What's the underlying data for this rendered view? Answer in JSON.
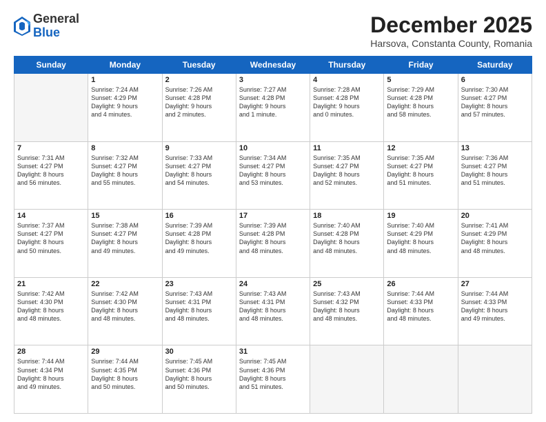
{
  "header": {
    "logo_general": "General",
    "logo_blue": "Blue",
    "month_title": "December 2025",
    "subtitle": "Harsova, Constanta County, Romania"
  },
  "weekdays": [
    "Sunday",
    "Monday",
    "Tuesday",
    "Wednesday",
    "Thursday",
    "Friday",
    "Saturday"
  ],
  "weeks": [
    [
      {
        "day": "",
        "detail": ""
      },
      {
        "day": "1",
        "detail": "Sunrise: 7:24 AM\nSunset: 4:29 PM\nDaylight: 9 hours\nand 4 minutes."
      },
      {
        "day": "2",
        "detail": "Sunrise: 7:26 AM\nSunset: 4:28 PM\nDaylight: 9 hours\nand 2 minutes."
      },
      {
        "day": "3",
        "detail": "Sunrise: 7:27 AM\nSunset: 4:28 PM\nDaylight: 9 hours\nand 1 minute."
      },
      {
        "day": "4",
        "detail": "Sunrise: 7:28 AM\nSunset: 4:28 PM\nDaylight: 9 hours\nand 0 minutes."
      },
      {
        "day": "5",
        "detail": "Sunrise: 7:29 AM\nSunset: 4:28 PM\nDaylight: 8 hours\nand 58 minutes."
      },
      {
        "day": "6",
        "detail": "Sunrise: 7:30 AM\nSunset: 4:27 PM\nDaylight: 8 hours\nand 57 minutes."
      }
    ],
    [
      {
        "day": "7",
        "detail": "Sunrise: 7:31 AM\nSunset: 4:27 PM\nDaylight: 8 hours\nand 56 minutes."
      },
      {
        "day": "8",
        "detail": "Sunrise: 7:32 AM\nSunset: 4:27 PM\nDaylight: 8 hours\nand 55 minutes."
      },
      {
        "day": "9",
        "detail": "Sunrise: 7:33 AM\nSunset: 4:27 PM\nDaylight: 8 hours\nand 54 minutes."
      },
      {
        "day": "10",
        "detail": "Sunrise: 7:34 AM\nSunset: 4:27 PM\nDaylight: 8 hours\nand 53 minutes."
      },
      {
        "day": "11",
        "detail": "Sunrise: 7:35 AM\nSunset: 4:27 PM\nDaylight: 8 hours\nand 52 minutes."
      },
      {
        "day": "12",
        "detail": "Sunrise: 7:35 AM\nSunset: 4:27 PM\nDaylight: 8 hours\nand 51 minutes."
      },
      {
        "day": "13",
        "detail": "Sunrise: 7:36 AM\nSunset: 4:27 PM\nDaylight: 8 hours\nand 51 minutes."
      }
    ],
    [
      {
        "day": "14",
        "detail": "Sunrise: 7:37 AM\nSunset: 4:27 PM\nDaylight: 8 hours\nand 50 minutes."
      },
      {
        "day": "15",
        "detail": "Sunrise: 7:38 AM\nSunset: 4:27 PM\nDaylight: 8 hours\nand 49 minutes."
      },
      {
        "day": "16",
        "detail": "Sunrise: 7:39 AM\nSunset: 4:28 PM\nDaylight: 8 hours\nand 49 minutes."
      },
      {
        "day": "17",
        "detail": "Sunrise: 7:39 AM\nSunset: 4:28 PM\nDaylight: 8 hours\nand 48 minutes."
      },
      {
        "day": "18",
        "detail": "Sunrise: 7:40 AM\nSunset: 4:28 PM\nDaylight: 8 hours\nand 48 minutes."
      },
      {
        "day": "19",
        "detail": "Sunrise: 7:40 AM\nSunset: 4:29 PM\nDaylight: 8 hours\nand 48 minutes."
      },
      {
        "day": "20",
        "detail": "Sunrise: 7:41 AM\nSunset: 4:29 PM\nDaylight: 8 hours\nand 48 minutes."
      }
    ],
    [
      {
        "day": "21",
        "detail": "Sunrise: 7:42 AM\nSunset: 4:30 PM\nDaylight: 8 hours\nand 48 minutes."
      },
      {
        "day": "22",
        "detail": "Sunrise: 7:42 AM\nSunset: 4:30 PM\nDaylight: 8 hours\nand 48 minutes."
      },
      {
        "day": "23",
        "detail": "Sunrise: 7:43 AM\nSunset: 4:31 PM\nDaylight: 8 hours\nand 48 minutes."
      },
      {
        "day": "24",
        "detail": "Sunrise: 7:43 AM\nSunset: 4:31 PM\nDaylight: 8 hours\nand 48 minutes."
      },
      {
        "day": "25",
        "detail": "Sunrise: 7:43 AM\nSunset: 4:32 PM\nDaylight: 8 hours\nand 48 minutes."
      },
      {
        "day": "26",
        "detail": "Sunrise: 7:44 AM\nSunset: 4:33 PM\nDaylight: 8 hours\nand 48 minutes."
      },
      {
        "day": "27",
        "detail": "Sunrise: 7:44 AM\nSunset: 4:33 PM\nDaylight: 8 hours\nand 49 minutes."
      }
    ],
    [
      {
        "day": "28",
        "detail": "Sunrise: 7:44 AM\nSunset: 4:34 PM\nDaylight: 8 hours\nand 49 minutes."
      },
      {
        "day": "29",
        "detail": "Sunrise: 7:44 AM\nSunset: 4:35 PM\nDaylight: 8 hours\nand 50 minutes."
      },
      {
        "day": "30",
        "detail": "Sunrise: 7:45 AM\nSunset: 4:36 PM\nDaylight: 8 hours\nand 50 minutes."
      },
      {
        "day": "31",
        "detail": "Sunrise: 7:45 AM\nSunset: 4:36 PM\nDaylight: 8 hours\nand 51 minutes."
      },
      {
        "day": "",
        "detail": ""
      },
      {
        "day": "",
        "detail": ""
      },
      {
        "day": "",
        "detail": ""
      }
    ]
  ]
}
